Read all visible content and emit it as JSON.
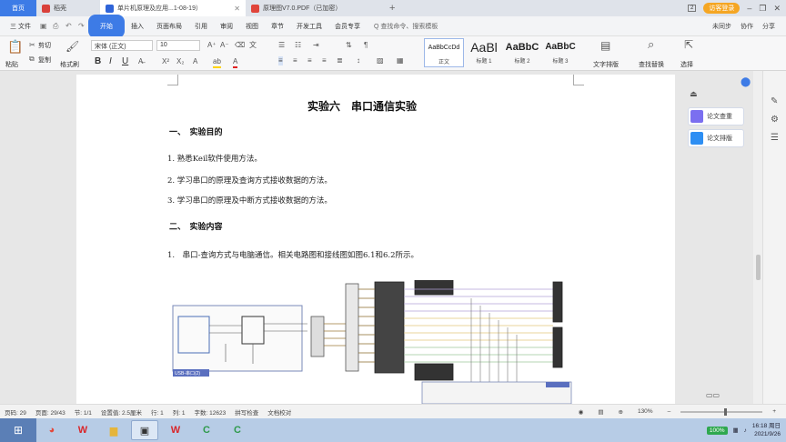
{
  "tabs": {
    "home": "首页",
    "items": [
      {
        "label": "稻壳",
        "icon_color": "#d9403a"
      },
      {
        "label": "单片机原理及应用...1-08-19）",
        "icon_color": "#2f64d8"
      },
      {
        "label": "原理图V7.0.PDF（已加密）",
        "icon_color": "#e0443a"
      }
    ],
    "badge": "2",
    "login": "访客登录",
    "window_controls": [
      "–",
      "❐",
      "✕"
    ]
  },
  "menu": {
    "file": "三 文件",
    "items": [
      "开始",
      "插入",
      "页面布局",
      "引用",
      "审阅",
      "视图",
      "章节",
      "开发工具",
      "会员专享"
    ],
    "search": "Q 查找命令、搜索模板",
    "right": [
      "未同步",
      "协作",
      "分享"
    ]
  },
  "ribbon": {
    "paste": "粘贴",
    "cut": "剪切",
    "copy": "复制",
    "format_painter": "格式刷",
    "font": "宋体 (正文)",
    "size": "10",
    "bold": "B",
    "italic": "I",
    "underline": "U",
    "styles": [
      {
        "preview": "AaBbCcDd",
        "name": "正文"
      },
      {
        "preview": "AaBl",
        "name": "标题 1"
      },
      {
        "preview": "AaBbC",
        "name": "标题 2"
      },
      {
        "preview": "AaBbC",
        "name": "标题 3"
      }
    ],
    "text_layout": "文字排版",
    "find_replace": "查找替换",
    "select": "选择"
  },
  "document": {
    "title": "实验六　串口通信实验",
    "section1": "一、　实验目的",
    "lines1": [
      "1.  熟悉Keil软件使用方法。",
      "2.  学习串口的原理及查询方式接收数据的方法。",
      "3.  学习串口的原理及中断方式接收数据的方法。"
    ],
    "section2": "二、　实验内容",
    "lines2": [
      "1.　串口-查询方式与电脑通信。相关电路图和接线图如图6.1和6.2所示。"
    ],
    "circuit_caption": "USB-串口(2)"
  },
  "sidepanel": {
    "check": "论文查重",
    "layout": "论文排版"
  },
  "status": {
    "items": [
      "页码: 29",
      "页面: 29/43",
      "节: 1/1",
      "设置值: 2.5厘米",
      "行: 1",
      "列: 1",
      "字数: 12623",
      "拼写检查",
      "文档校对"
    ],
    "zoom": "130%"
  },
  "taskbar": {
    "battery": "100%",
    "time": "16:18 周日",
    "date": "2021/9/26"
  }
}
